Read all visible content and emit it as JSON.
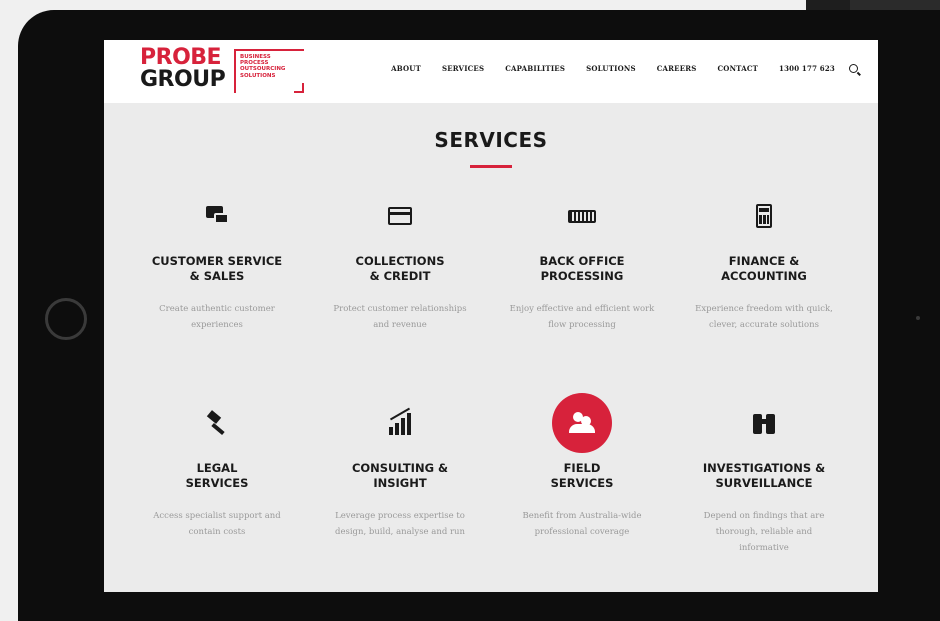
{
  "colors": {
    "accent": "#d7223b",
    "text": "#1a1a1a",
    "muted": "#9a9a9a"
  },
  "logo": {
    "line1": "PROBE",
    "line2": "GROUP",
    "tagline": [
      "BUSINESS",
      "PROCESS",
      "OUTSOURCING",
      "SOLUTIONS"
    ]
  },
  "nav": {
    "items": [
      "ABOUT",
      "SERVICES",
      "CAPABILITIES",
      "SOLUTIONS",
      "CAREERS",
      "CONTACT"
    ],
    "phone": "1300 177 623",
    "search_icon": "search-icon"
  },
  "page_title": "SERVICES",
  "services": [
    {
      "icon": "chat-bubbles-icon",
      "title": "CUSTOMER SERVICE\n& SALES",
      "desc": "Create authentic customer\nexperiences"
    },
    {
      "icon": "credit-card-icon",
      "title": "COLLECTIONS\n& CREDIT",
      "desc": "Protect customer relationships\nand revenue"
    },
    {
      "icon": "keyboard-icon",
      "title": "BACK OFFICE\nPROCESSING",
      "desc": "Enjoy effective and efficient work\nflow processing"
    },
    {
      "icon": "calculator-icon",
      "title": "FINANCE &\nACCOUNTING",
      "desc": "Experience freedom with quick,\nclever, accurate solutions"
    },
    {
      "icon": "gavel-icon",
      "title": "LEGAL\nSERVICES",
      "desc": "Access specialist support and\ncontain costs"
    },
    {
      "icon": "growth-chart-icon",
      "title": "CONSULTING &\nINSIGHT",
      "desc": "Leverage process expertise to\ndesign, build, analyse and run"
    },
    {
      "icon": "people-icon",
      "title": "FIELD\nSERVICES",
      "desc": "Benefit from Australia-wide\nprofessional coverage"
    },
    {
      "icon": "binoculars-icon",
      "title": "INVESTIGATIONS &\nSURVEILLANCE",
      "desc": "Depend on findings that are\nthorough, reliable and\ninformative"
    }
  ]
}
